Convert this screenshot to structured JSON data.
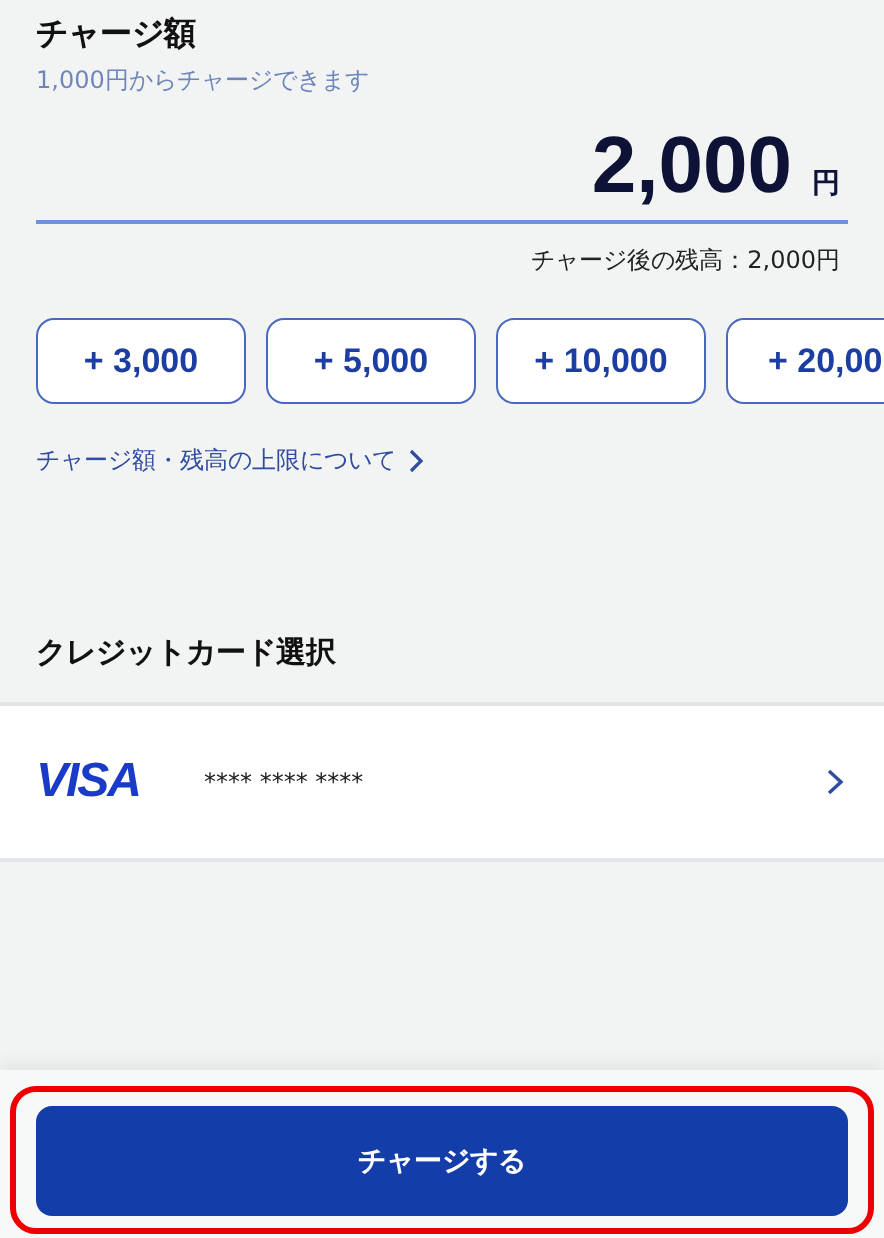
{
  "charge": {
    "title": "チャージ額",
    "subtitle": "1,000円からチャージできます",
    "amount": "2,000",
    "unit": "円",
    "balance": "チャージ後の残高：2,000円"
  },
  "quick_amounts": [
    "+ 3,000",
    "+ 5,000",
    "+ 10,000",
    "+ 20,00"
  ],
  "limit_link": "チャージ額・残高の上限について",
  "card_section": {
    "title": "クレジットカード選択",
    "brand": "VISA",
    "number": "**** **** ****"
  },
  "submit_button": "チャージする"
}
